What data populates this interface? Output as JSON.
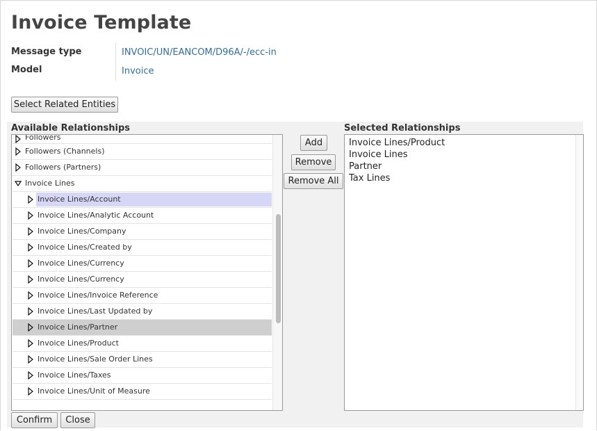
{
  "page": {
    "title": "Invoice Template"
  },
  "fields": [
    {
      "label": "Message type",
      "value": "INVOIC/UN/EANCOM/D96A/-/ecc-in"
    },
    {
      "label": "Model",
      "value": "Invoice"
    }
  ],
  "buttons": {
    "select_related": "Select Related Entities",
    "add": "Add",
    "remove": "Remove",
    "remove_all": "Remove All",
    "confirm": "Confirm",
    "close": "Close"
  },
  "available": {
    "title": "Available Relationships",
    "items": [
      {
        "label": "Followers",
        "expanded": false,
        "child": false
      },
      {
        "label": "Followers (Channels)",
        "expanded": false,
        "child": false
      },
      {
        "label": "Followers (Partners)",
        "expanded": false,
        "child": false
      },
      {
        "label": "Invoice Lines",
        "expanded": true,
        "child": false
      },
      {
        "label": "Invoice Lines/Account",
        "expanded": false,
        "child": true,
        "highlight": "focused"
      },
      {
        "label": "Invoice Lines/Analytic Account",
        "expanded": false,
        "child": true
      },
      {
        "label": "Invoice Lines/Company",
        "expanded": false,
        "child": true
      },
      {
        "label": "Invoice Lines/Created by",
        "expanded": false,
        "child": true
      },
      {
        "label": "Invoice Lines/Currency",
        "expanded": false,
        "child": true
      },
      {
        "label": "Invoice Lines/Currency",
        "expanded": false,
        "child": true
      },
      {
        "label": "Invoice Lines/Invoice Reference",
        "expanded": false,
        "child": true
      },
      {
        "label": "Invoice Lines/Last Updated by",
        "expanded": false,
        "child": true
      },
      {
        "label": "Invoice Lines/Partner",
        "expanded": false,
        "child": true,
        "highlight": "selected"
      },
      {
        "label": "Invoice Lines/Product",
        "expanded": false,
        "child": true
      },
      {
        "label": "Invoice Lines/Sale Order Lines",
        "expanded": false,
        "child": true
      },
      {
        "label": "Invoice Lines/Taxes",
        "expanded": false,
        "child": true
      },
      {
        "label": "Invoice Lines/Unit of Measure",
        "expanded": false,
        "child": true
      }
    ]
  },
  "selected": {
    "title": "Selected Relationships",
    "items": [
      "Invoice Lines/Product",
      "Invoice Lines",
      "Partner",
      "Tax Lines"
    ]
  },
  "icons": {
    "collapsed": "triangle-right-icon",
    "expanded": "triangle-down-icon"
  },
  "colors": {
    "link": "#2f6fa8",
    "focus_row": "#d6d6f6",
    "selected_row": "#cfcfcf"
  }
}
